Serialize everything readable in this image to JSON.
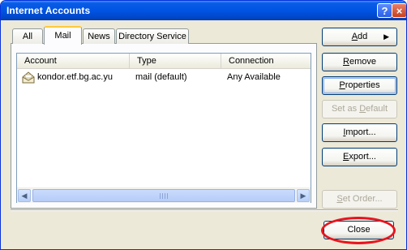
{
  "window": {
    "title": "Internet Accounts",
    "help_glyph": "?",
    "close_glyph": "×"
  },
  "tabs": [
    {
      "label": "All",
      "active": false
    },
    {
      "label": "Mail",
      "active": true
    },
    {
      "label": "News",
      "active": false
    },
    {
      "label": "Directory Service",
      "active": false
    }
  ],
  "list": {
    "columns": [
      "Account",
      "Type",
      "Connection"
    ],
    "rows": [
      {
        "account": "kondor.etf.bg.ac.yu",
        "type": "mail (default)",
        "connection": "Any Available"
      }
    ]
  },
  "buttons": {
    "add": "Add",
    "add_access": "A",
    "add_rest": "dd",
    "remove_access": "R",
    "remove_rest": "emove",
    "properties_access": "P",
    "properties_rest": "roperties",
    "set_default_pre": "Set as ",
    "set_default_access": "D",
    "set_default_post": "efault",
    "import_access": "I",
    "import_rest": "mport...",
    "export_access": "E",
    "export_rest": "xport...",
    "set_order_pre": "",
    "set_order_access": "S",
    "set_order_post": "et Order...",
    "close_label": "Close"
  },
  "icons": {
    "account": "mail-account-icon",
    "arrow": "triangle-right-icon"
  },
  "colors": {
    "titlebar": "#0054e3",
    "focus_ring": "#e8141e",
    "tab_highlight": "#ffc83c"
  }
}
